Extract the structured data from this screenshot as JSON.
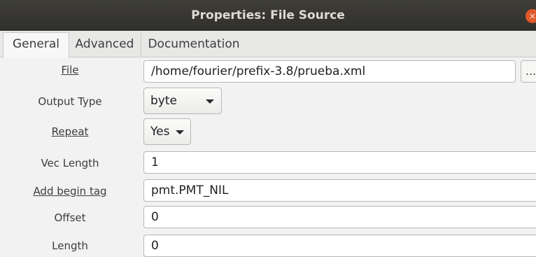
{
  "window": {
    "title": "Properties: File Source",
    "close_glyph": "×"
  },
  "tabs": [
    {
      "label": "General"
    },
    {
      "label": "Advanced"
    },
    {
      "label": "Documentation"
    }
  ],
  "fields": {
    "file": {
      "label": "File",
      "value": "/home/fourier/prefix-3.8/prueba.xml",
      "browse_label": "..."
    },
    "output_type": {
      "label": "Output Type",
      "value": "byte"
    },
    "repeat": {
      "label": "Repeat",
      "value": "Yes"
    },
    "vec_length": {
      "label": "Vec Length",
      "value": "1"
    },
    "add_begin_tag": {
      "label": "Add begin tag",
      "value": "pmt.PMT_NIL"
    },
    "offset": {
      "label": "Offset",
      "value": "0"
    },
    "length": {
      "label": "Length",
      "value": "0"
    }
  }
}
